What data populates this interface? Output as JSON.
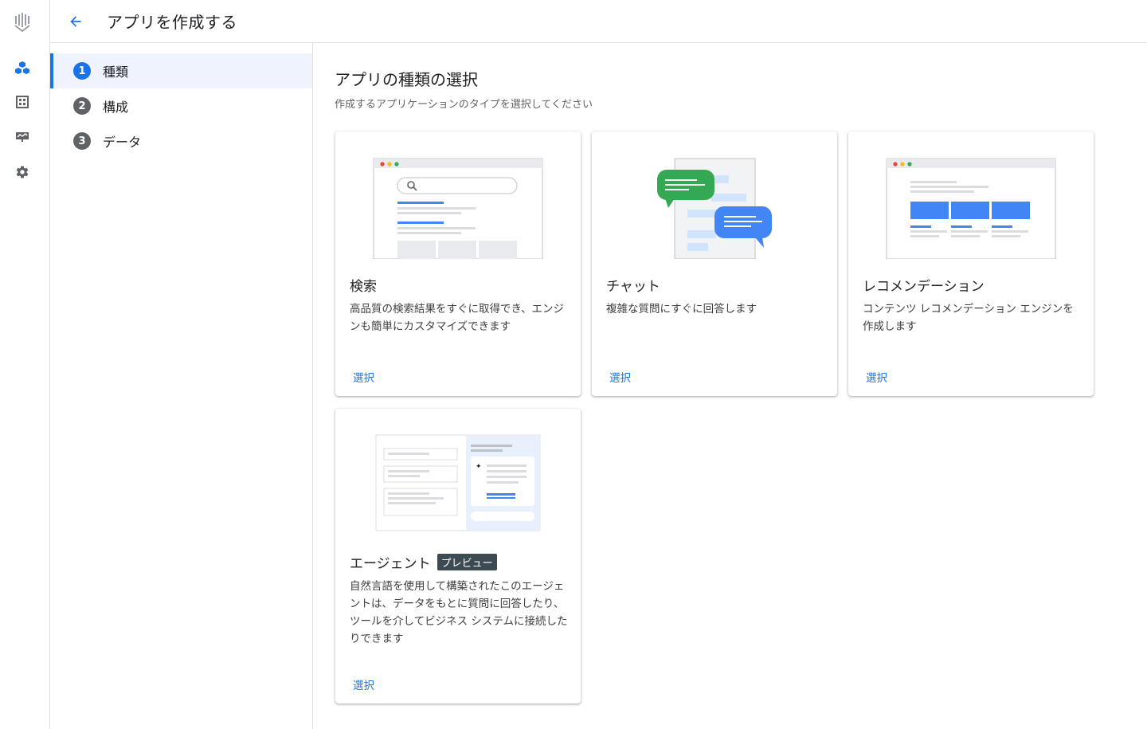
{
  "header": {
    "title": "アプリを作成する"
  },
  "rail": {
    "items": [
      "apps-icon",
      "dashboard-icon",
      "monitor-icon",
      "settings-icon"
    ]
  },
  "steps": [
    {
      "number": "1",
      "label": "種類",
      "active": true
    },
    {
      "number": "2",
      "label": "構成",
      "active": false
    },
    {
      "number": "3",
      "label": "データ",
      "active": false
    }
  ],
  "main": {
    "title": "アプリの種類の選択",
    "subtitle": "作成するアプリケーションのタイプを選択してください"
  },
  "cards": [
    {
      "title": "検索",
      "description": "高品質の検索結果をすぐに取得でき、エンジンも簡単にカスタマイズできます",
      "action": "選択"
    },
    {
      "title": "チャット",
      "description": "複雑な質問にすぐに回答します",
      "action": "選択"
    },
    {
      "title": "レコメンデーション",
      "description": "コンテンツ レコメンデーション エンジンを作成します",
      "action": "選択"
    },
    {
      "title": "エージェント",
      "badge": "プレビュー",
      "description": "自然言語を使用して構築されたこのエージェントは、データをもとに質問に回答したり、ツールを介してビジネス システムに接続したりできます",
      "action": "選択"
    }
  ],
  "colors": {
    "accent": "#1a73e8",
    "green": "#34a853",
    "badge": "#3c4a52"
  }
}
